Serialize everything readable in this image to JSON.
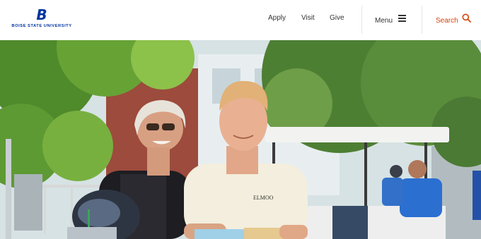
{
  "header": {
    "logo_mark": "B",
    "logo_text": "BOISE STATE UNIVERSITY",
    "nav": [
      {
        "label": "Apply"
      },
      {
        "label": "Visit"
      },
      {
        "label": "Give"
      }
    ],
    "menu_label": "Menu",
    "search_label": "Search"
  },
  "colors": {
    "brand_blue": "#0033a0",
    "accent_orange": "#d64309",
    "text_dark": "#333333"
  },
  "hero": {
    "shirt_text": "ELMOO"
  }
}
